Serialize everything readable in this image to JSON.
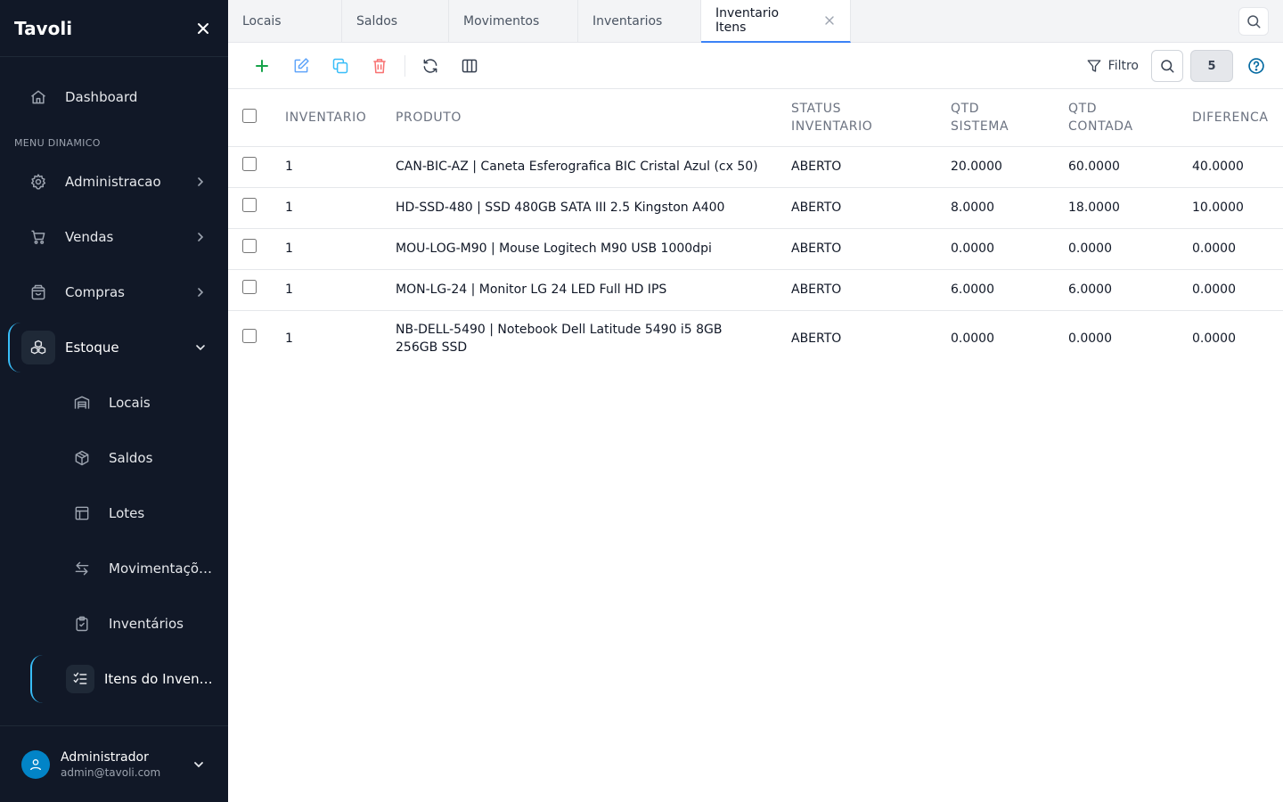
{
  "app": {
    "title": "Tavoli"
  },
  "sidebar": {
    "dashboard": "Dashboard",
    "section_label": "MENU DINAMICO",
    "items": [
      {
        "label": "Administracao",
        "icon": "gear-icon"
      },
      {
        "label": "Vendas",
        "icon": "cart-icon"
      },
      {
        "label": "Compras",
        "icon": "bag-icon"
      },
      {
        "label": "Estoque",
        "icon": "cubes-icon"
      }
    ],
    "estoque_children": [
      {
        "label": "Locais",
        "icon": "warehouse-icon"
      },
      {
        "label": "Saldos",
        "icon": "package-icon"
      },
      {
        "label": "Lotes",
        "icon": "layout-icon"
      },
      {
        "label": "Movimentações",
        "icon": "arrows-exchange-icon"
      },
      {
        "label": "Inventários",
        "icon": "clipboard-check-icon"
      },
      {
        "label": "Itens do Inventário",
        "icon": "list-check-icon"
      }
    ],
    "user": {
      "name": "Administrador",
      "email": "admin@tavoli.com"
    }
  },
  "tabs": [
    "Locais",
    "Saldos",
    "Movimentos",
    "Inventarios",
    "Inventario Itens"
  ],
  "active_tab_index": 4,
  "toolbar": {
    "filter_label": "Filtro",
    "count": "5"
  },
  "colors": {
    "sidebar_bg": "#111827",
    "accent": "#38bdf8",
    "tab_active_border": "#3b82f6",
    "add": "#16a34a",
    "edit": "#60a5fa",
    "copy": "#38bdf8",
    "delete": "#f87171"
  },
  "table": {
    "columns": [
      {
        "l1": "INVENTARIO",
        "l2": ""
      },
      {
        "l1": "PRODUTO",
        "l2": ""
      },
      {
        "l1": "STATUS",
        "l2": "INVENTARIO"
      },
      {
        "l1": "QTD",
        "l2": "SISTEMA"
      },
      {
        "l1": "QTD",
        "l2": "CONTADA"
      },
      {
        "l1": "DIFERENCA",
        "l2": ""
      }
    ],
    "rows": [
      {
        "inventario": "1",
        "produto": "CAN-BIC-AZ | Caneta Esferografica BIC Cristal Azul (cx 50)",
        "status": "ABERTO",
        "qtd_sistema": "20.0000",
        "qtd_contada": "60.0000",
        "diferenca": "40.0000"
      },
      {
        "inventario": "1",
        "produto": "HD-SSD-480 | SSD 480GB SATA III 2.5 Kingston A400",
        "status": "ABERTO",
        "qtd_sistema": "8.0000",
        "qtd_contada": "18.0000",
        "diferenca": "10.0000"
      },
      {
        "inventario": "1",
        "produto": "MOU-LOG-M90 | Mouse Logitech M90 USB 1000dpi",
        "status": "ABERTO",
        "qtd_sistema": "0.0000",
        "qtd_contada": "0.0000",
        "diferenca": "0.0000"
      },
      {
        "inventario": "1",
        "produto": "MON-LG-24 | Monitor LG 24 LED Full HD IPS",
        "status": "ABERTO",
        "qtd_sistema": "6.0000",
        "qtd_contada": "6.0000",
        "diferenca": "0.0000"
      },
      {
        "inventario": "1",
        "produto": "NB-DELL-5490 | Notebook Dell Latitude 5490 i5 8GB 256GB SSD",
        "status": "ABERTO",
        "qtd_sistema": "0.0000",
        "qtd_contada": "0.0000",
        "diferenca": "0.0000"
      }
    ]
  }
}
